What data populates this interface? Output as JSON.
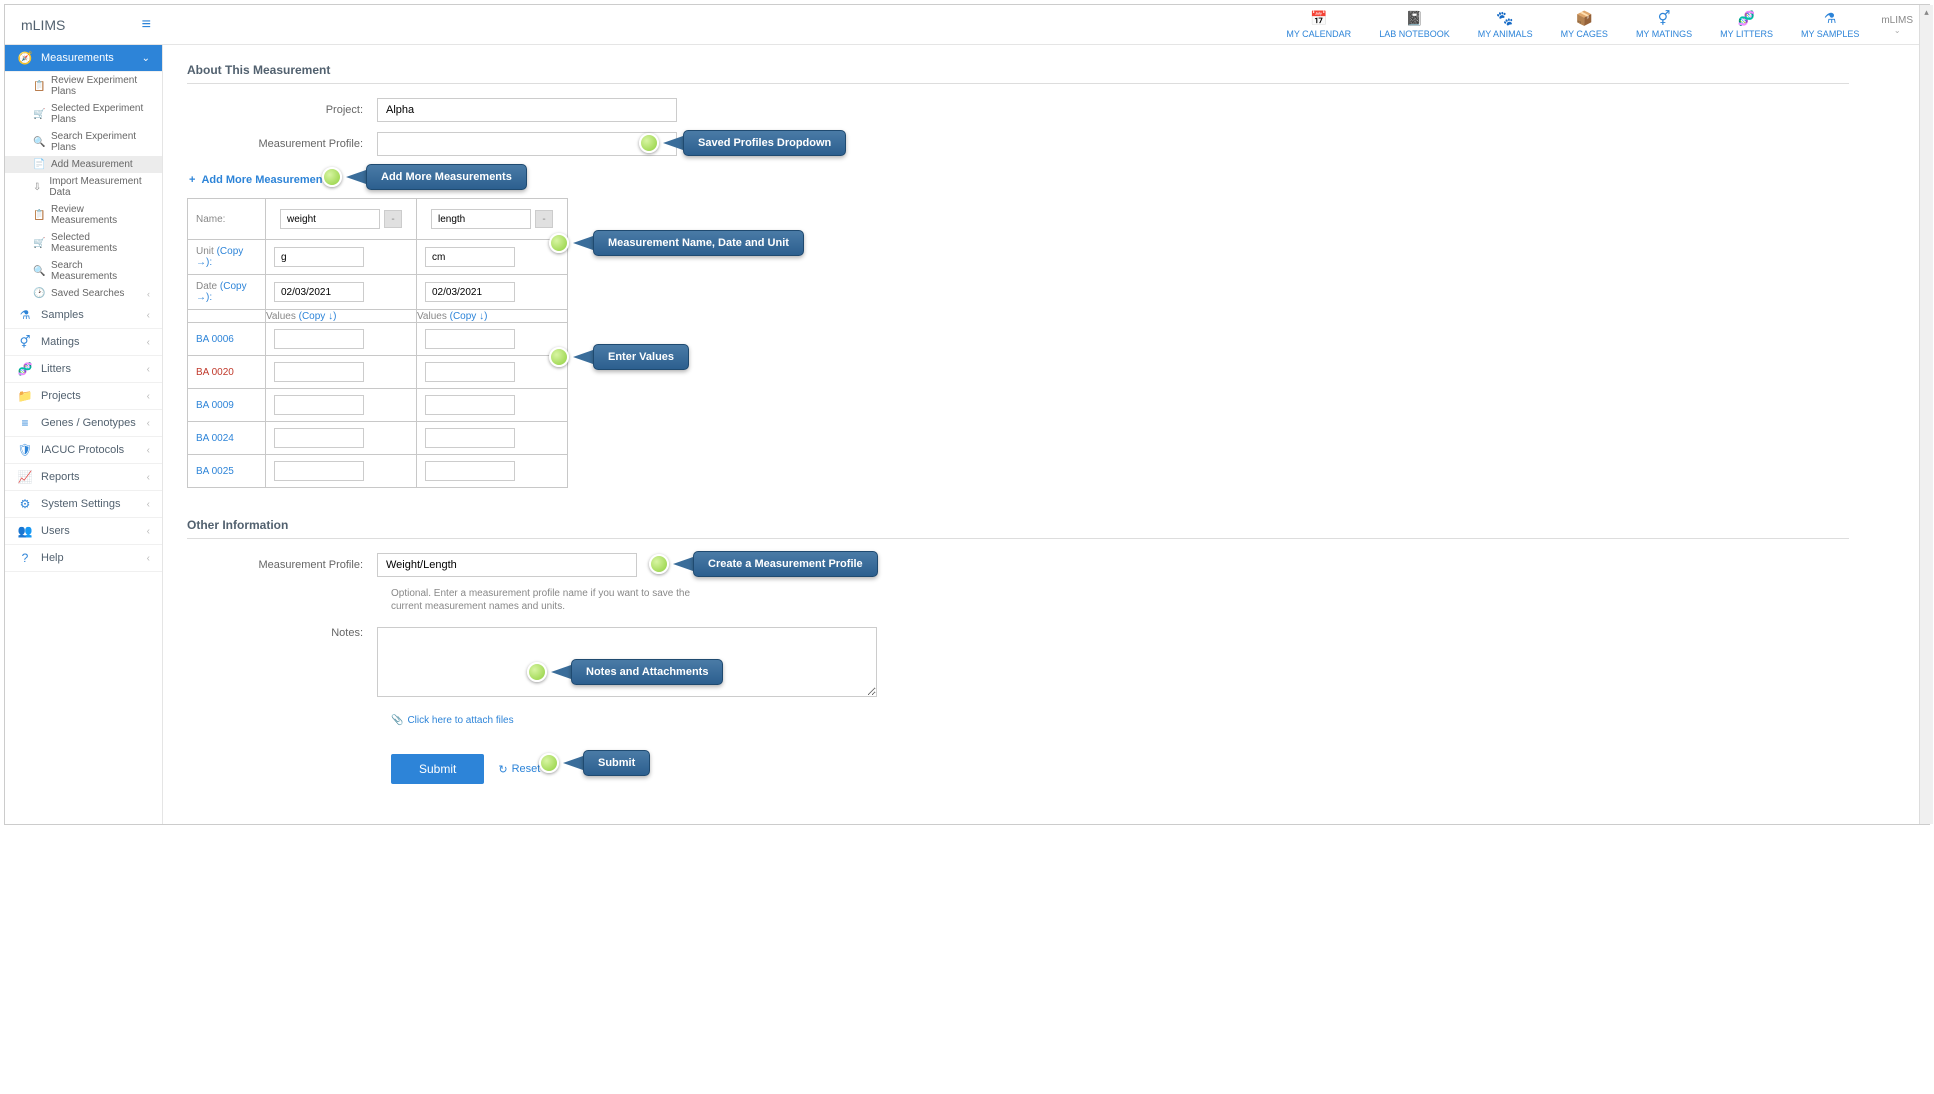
{
  "app_name": "mLIMS",
  "user_label": "mLIMS",
  "topnav": [
    {
      "label": "MY CALENDAR",
      "icon": "📅"
    },
    {
      "label": "LAB NOTEBOOK",
      "icon": "📓"
    },
    {
      "label": "MY ANIMALS",
      "icon": "🐾"
    },
    {
      "label": "MY CAGES",
      "icon": "📦"
    },
    {
      "label": "MY MATINGS",
      "icon": "⚥"
    },
    {
      "label": "MY LITTERS",
      "icon": "🧬"
    },
    {
      "label": "MY SAMPLES",
      "icon": "⚗"
    }
  ],
  "sidebar": {
    "measurements": {
      "label": "Measurements"
    },
    "sub": [
      {
        "label": "Review Experiment Plans",
        "icon": "📋"
      },
      {
        "label": "Selected Experiment Plans",
        "icon": "🛒"
      },
      {
        "label": "Search Experiment Plans",
        "icon": "🔍"
      },
      {
        "label": "Add Measurement",
        "icon": "📄",
        "selected": true
      },
      {
        "label": "Import Measurement Data",
        "icon": "⇩"
      },
      {
        "label": "Review Measurements",
        "icon": "📋"
      },
      {
        "label": "Selected Measurements",
        "icon": "🛒"
      },
      {
        "label": "Search Measurements",
        "icon": "🔍"
      },
      {
        "label": "Saved Searches",
        "icon": "🕑"
      }
    ],
    "items": [
      {
        "label": "Samples",
        "icon": "⚗"
      },
      {
        "label": "Matings",
        "icon": "⚥"
      },
      {
        "label": "Litters",
        "icon": "🧬"
      },
      {
        "label": "Projects",
        "icon": "📁"
      },
      {
        "label": "Genes / Genotypes",
        "icon": "≡"
      },
      {
        "label": "IACUC Protocols",
        "icon": "🛡"
      },
      {
        "label": "Reports",
        "icon": "📈"
      },
      {
        "label": "System Settings",
        "icon": "⚙"
      },
      {
        "label": "Users",
        "icon": "👥"
      },
      {
        "label": "Help",
        "icon": "?"
      }
    ]
  },
  "about": {
    "title": "About This Measurement",
    "project_label": "Project:",
    "project_value": "Alpha",
    "profile_label": "Measurement Profile:",
    "profile_value": ""
  },
  "add_more": "Add More Measurements",
  "table": {
    "name_label": "Name:",
    "unit_label": "Unit",
    "copy_right": "(Copy →):",
    "date_label": "Date",
    "values_label": "Values",
    "copy_down": "(Copy ↓)",
    "cols": [
      {
        "name": "weight",
        "unit": "g",
        "date": "02/03/2021"
      },
      {
        "name": "length",
        "unit": "cm",
        "date": "02/03/2021"
      }
    ],
    "rows": [
      {
        "id": "BA 0006",
        "cls": "blue"
      },
      {
        "id": "BA 0020",
        "cls": "red"
      },
      {
        "id": "BA 0009",
        "cls": "blue"
      },
      {
        "id": "BA 0024",
        "cls": "blue"
      },
      {
        "id": "BA 0025",
        "cls": "blue"
      }
    ]
  },
  "other": {
    "title": "Other Information",
    "profile_label": "Measurement Profile:",
    "profile_value": "Weight/Length",
    "profile_hint": "Optional. Enter a measurement profile name if you want to save the current measurement names and units.",
    "notes_label": "Notes:",
    "attach_label": "Click here to attach files",
    "submit": "Submit",
    "reset": "Reset"
  },
  "callouts": {
    "c1": "Saved Profiles Dropdown",
    "c2": "Add More Measurements",
    "c3": "Measurement Name, Date and Unit",
    "c4": "Enter Values",
    "c5": "Create a Measurement Profile",
    "c6": "Notes and Attachments",
    "c7": "Submit"
  }
}
